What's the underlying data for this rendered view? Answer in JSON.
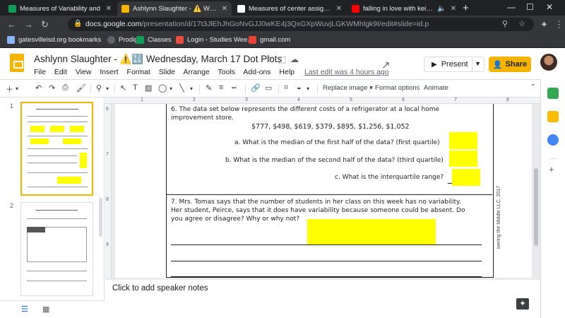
{
  "browser": {
    "tabs": [
      {
        "title": "Measures of Variability and",
        "favicon_color": "#0f9d58",
        "active": false
      },
      {
        "title": "Ashlynn Slaughter - ⚠️ Wedne",
        "favicon_color": "#f4b400",
        "active": true
      },
      {
        "title": "Measures of center assignment",
        "favicon_color": "#ffffff",
        "active": false
      },
      {
        "title": "falling in love with keigo taka",
        "favicon_color": "#ff0000",
        "active": false
      }
    ],
    "url_host": "docs.google.com",
    "url_path": "/presentation/d/17t3JlEhJhGoNvGJJ0wKE4j3QxGXpWuvjLGKWMhlgk9I/edit#slide=id.p",
    "bookmarks": [
      {
        "label": "gatesvilleisd.org bookmarks",
        "icon_color": "#8ab4f8"
      },
      {
        "label": "Prodigy",
        "icon_color": "#5f6368"
      },
      {
        "label": "Classes",
        "icon_color": "#0f9d58"
      },
      {
        "label": "Login - Studies Wee...",
        "icon_color": "#e74c3c"
      },
      {
        "label": "gmail.com",
        "icon_color": "#ea4335"
      }
    ]
  },
  "docs": {
    "title": "Ashlynn Slaughter - ⚠️🔣 Wednesday, March 17 Dot Plots",
    "menu": [
      "File",
      "Edit",
      "View",
      "Insert",
      "Format",
      "Slide",
      "Arrange",
      "Tools",
      "Add-ons",
      "Help"
    ],
    "last_edit": "Last edit was 4 hours ago",
    "present_label": "Present",
    "share_label": "Share",
    "accent_color": "#f4b400"
  },
  "toolbar": {
    "replace_image": "Replace image ▾",
    "format_options": "Format options",
    "animate": "Animate"
  },
  "ruler": {
    "h_ticks": [
      "1",
      "2",
      "3",
      "4",
      "5",
      "6",
      "7",
      "8"
    ],
    "v_ticks": [
      "6",
      "7",
      "8",
      "9"
    ]
  },
  "filmstrip": {
    "slides": [
      {
        "number": "1",
        "selected": true
      },
      {
        "number": "2",
        "selected": false
      }
    ]
  },
  "worksheet": {
    "q6_line1": "6.  The data set below represents the different costs of a refrigerator at a local home",
    "q6_line2": "improvement store.",
    "data_set": "$777, $498, $619, $379, $895, $1,256, $1,052",
    "qa": "a.  What is the median of the first half of the data? (first quartile)",
    "qb": "b.  What is the median of the second half of the data? (third quartile)",
    "qc": "c.  What is the interquartile range? ",
    "q7_line1": "7.  Mrs. Tomas says that the number of students in her class on this week has no variability.",
    "q7_line2": "Her student, Peirce, says that it does have variability because someone could be absent.  Do",
    "q7_line3": "you agree or disagree?  Why or why not?",
    "copyright": "ivering the Middle LLC, 2017",
    "highlight_color": "#ffff00"
  },
  "notes": {
    "placeholder": "Click to add speaker notes"
  }
}
